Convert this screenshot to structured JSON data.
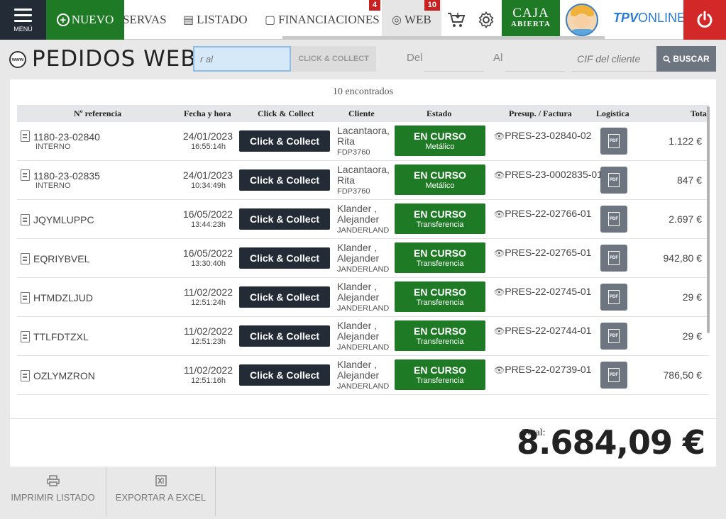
{
  "topbar": {
    "menu_label": "MENÚ",
    "nuevo_label": "NUEVO",
    "tabs": [
      {
        "label": "SERVAS"
      },
      {
        "label": "LISTADO"
      },
      {
        "label": "FINANCIACIONES",
        "badge": "4"
      },
      {
        "label": "WEB",
        "badge": "10"
      }
    ],
    "caja_line1": "CAJA",
    "caja_line2": "ABIERTA",
    "logo_bold": "TPV",
    "logo_rest": "ONLINE",
    "accent_green": "#1e7a24",
    "accent_red": "#d32828"
  },
  "page": {
    "title": "PEDIDOS WEB",
    "search_placeholder": "r al",
    "cc_filter_label": "CLICK & COLLECT",
    "del_label": "Del",
    "al_label": "Al",
    "cif_placeholder": "CIF del cliente",
    "buscar_label": "BUSCAR"
  },
  "table": {
    "found_text": "10 encontrados",
    "headers": {
      "ref": "Nº referencia",
      "date": "Fecha y hora",
      "cc": "Click & Collect",
      "client": "Cliente",
      "status": "Estado",
      "presup": "Presup. / Factura",
      "logistics": "Logística",
      "total": "Total"
    },
    "rows": [
      {
        "ref": "1180-23-02840",
        "ref_sub": "INTERNO",
        "date": "24/01/2023",
        "time": "16:55:14h",
        "cc_label": "Click & Collect",
        "client_l1": "Lacantaora,",
        "client_l2": "Rita",
        "client_code": "FDP3760",
        "status": "EN CURSO",
        "status_sub": "Metálico",
        "presup": "PRES-23-02840-02",
        "total": "1.122 €"
      },
      {
        "ref": "1180-23-02835",
        "ref_sub": "INTERNO",
        "date": "24/01/2023",
        "time": "10:34:49h",
        "cc_label": "Click & Collect",
        "client_l1": "Lacantaora,",
        "client_l2": "Rita",
        "client_code": "FDP3760",
        "status": "EN CURSO",
        "status_sub": "Metálico",
        "presup": "PRES-23-0002835-01",
        "total": "847 €"
      },
      {
        "ref": "JQYMLUPPC",
        "ref_sub": "",
        "date": "16/05/2022",
        "time": "13:44:23h",
        "cc_label": "Click & Collect",
        "client_l1": "Klander ,",
        "client_l2": "Alejander",
        "client_code": "JANDERLAND",
        "status": "EN CURSO",
        "status_sub": "Transferencia",
        "presup": "PRES-22-02766-01",
        "total": "2.697 €"
      },
      {
        "ref": "EQRIYBVEL",
        "ref_sub": "",
        "date": "16/05/2022",
        "time": "13:30:40h",
        "cc_label": "Click & Collect",
        "client_l1": "Klander ,",
        "client_l2": "Alejander",
        "client_code": "JANDERLAND",
        "status": "EN CURSO",
        "status_sub": "Transferencia",
        "presup": "PRES-22-02765-01",
        "total": "942,80 €"
      },
      {
        "ref": "HTMDZLJUD",
        "ref_sub": "",
        "date": "11/02/2022",
        "time": "12:51:24h",
        "cc_label": "Click & Collect",
        "client_l1": "Klander ,",
        "client_l2": "Alejander",
        "client_code": "JANDERLAND",
        "status": "EN CURSO",
        "status_sub": "Transferencia",
        "presup": "PRES-22-02745-01",
        "total": "29 €"
      },
      {
        "ref": "TTLFDTZXL",
        "ref_sub": "",
        "date": "11/02/2022",
        "time": "12:51:23h",
        "cc_label": "Click & Collect",
        "client_l1": "Klander ,",
        "client_l2": "Alejander",
        "client_code": "JANDERLAND",
        "status": "EN CURSO",
        "status_sub": "Transferencia",
        "presup": "PRES-22-02744-01",
        "total": "29 €"
      },
      {
        "ref": "OZLYMZRON",
        "ref_sub": "",
        "date": "11/02/2022",
        "time": "12:51:16h",
        "cc_label": "Click & Collect",
        "client_l1": "Klander ,",
        "client_l2": "Alejander",
        "client_code": "JANDERLAND",
        "status": "EN CURSO",
        "status_sub": "Transferencia",
        "presup": "PRES-22-02739-01",
        "total": "786,50 €"
      }
    ],
    "pdf_label": "PDF",
    "total_label": "Total:",
    "total_value": "8.684,09 €"
  },
  "footer": {
    "print_label": "IMPRIMIR LISTADO",
    "excel_label": "EXPORTAR A EXCEL"
  }
}
